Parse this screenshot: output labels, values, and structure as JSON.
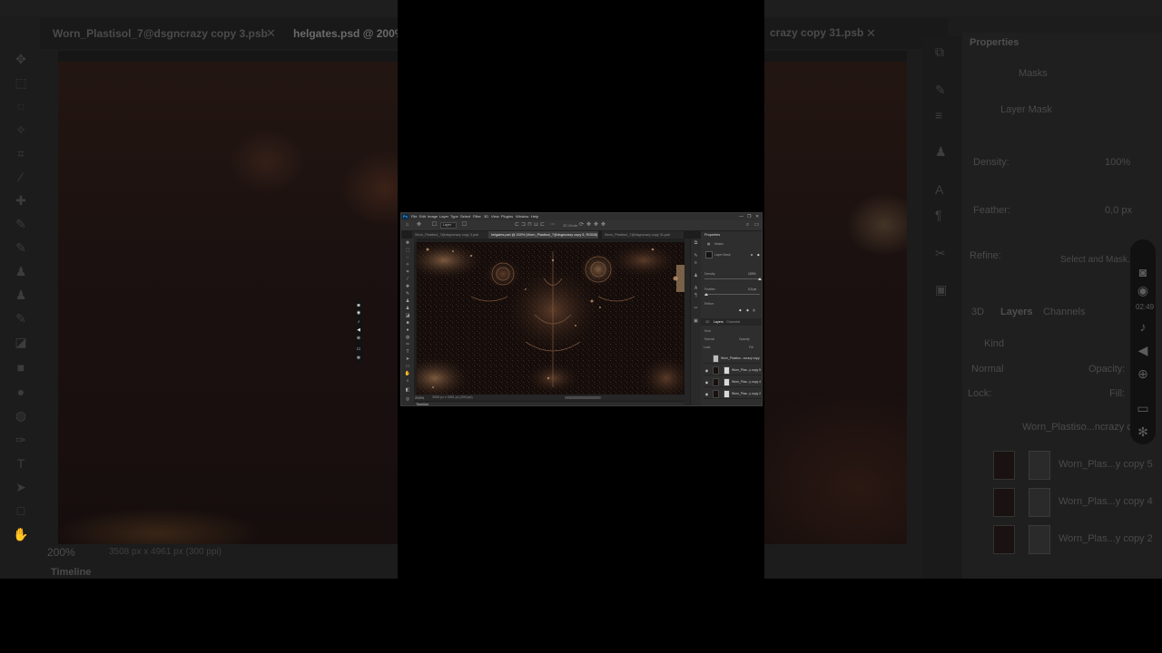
{
  "background": {
    "tabs": [
      {
        "label": "Worn_Plastisol_7@dsgncrazy copy 3.psb",
        "active": false
      },
      {
        "label": "helgates.psd @ 200%",
        "active": true
      }
    ],
    "right_tab_label": "crazy copy 31.psb",
    "status_zoom": "200%",
    "status_info": "3508 px x 4961 px (300 ppi)",
    "timeline_label": "Timeline",
    "panel": {
      "title": "Properties",
      "masks_label": "Masks",
      "layer_mask_label": "Layer Mask",
      "density_label": "Density:",
      "density_value": "100%",
      "feather_label": "Feather:",
      "feather_value": "0,0 px",
      "refine_label": "Refine:",
      "select_and_mask": "Select and Mask...",
      "tabs": [
        "3D",
        "Layers",
        "Channels"
      ],
      "kind_label": "Kind",
      "blend_mode": "Normal",
      "opacity_label": "Opacity:",
      "lock_label": "Lock:",
      "fill_label": "Fill:",
      "layers": [
        {
          "name": "Worn_Plastiso...ncrazy copy",
          "visible": false
        },
        {
          "name": "Worn_Plas...y copy 5",
          "visible": true
        },
        {
          "name": "Worn_Plas...y copy 4",
          "visible": true
        },
        {
          "name": "Worn_Plas...y copy 2",
          "visible": true
        }
      ]
    },
    "recorder_time": "02:49"
  },
  "window": {
    "menu": [
      "File",
      "Edit",
      "Image",
      "Layer",
      "Type",
      "Select",
      "Filter",
      "3D",
      "View",
      "Plugins",
      "Window",
      "Help"
    ],
    "window_controls": [
      "—",
      "❐",
      "✕"
    ],
    "options": {
      "select_value": "Layer",
      "text_3d_mode": "3D Mode:"
    },
    "tabs": [
      {
        "label": "Worn_Plastisol_7@dsgncrazy copy 3.psb",
        "active": false
      },
      {
        "label": "helgates.psd @ 200% (Worn_Plastisol_7@dsgncrazy copy 5, RGB/8)",
        "active": true
      },
      {
        "label": "Worn_Plastisol_7@dsgncrazy copy 31.psb",
        "active": false
      }
    ],
    "status": {
      "zoom": "200%",
      "info": "3508 px x 4961 px (300 ppi)"
    },
    "timeline_label": "Timeline",
    "properties": {
      "title": "Properties",
      "masks_label": "Masks",
      "layer_mask_label": "Layer Mask",
      "density_label": "Density:",
      "density_value": "100%",
      "feather_label": "Feather:",
      "feather_value": "0,0 px",
      "refine_label": "Refine:"
    },
    "layers_panel": {
      "tabs": [
        "3D",
        "Layers",
        "Channels"
      ],
      "kind_label": "Kind",
      "blend_mode": "Normal",
      "opacity_label": "Opacity:",
      "lock_label": "Lock:",
      "fill_label": "Fill:",
      "layers": [
        {
          "name": "Worn_Plastiso...ncrazy copy",
          "visible": false
        },
        {
          "name": "Worn_Plas...y copy 5",
          "visible": true
        },
        {
          "name": "Worn_Plas...y copy 4",
          "visible": true
        },
        {
          "name": "Worn_Plas...y copy 2",
          "visible": true
        }
      ]
    }
  },
  "colors": {
    "app_bg": "#262626",
    "panel_bg": "#2e2e2e",
    "accent": "#31a8ff",
    "canvas_base": "#160e0c",
    "canvas_highlight": "#a87a55"
  },
  "icons": {
    "tools": [
      "move-icon",
      "marquee-icon",
      "lasso-icon",
      "magic-wand-icon",
      "crop-icon",
      "eyedropper-icon",
      "healing-icon",
      "brush-icon",
      "stamp-icon",
      "history-brush-icon",
      "eraser-icon",
      "gradient-icon",
      "blur-icon",
      "dodge-icon",
      "pen-icon",
      "type-icon",
      "path-select-icon",
      "shape-icon",
      "hand-icon",
      "zoom-icon"
    ],
    "recorder": [
      "camera-icon",
      "record-icon",
      "mic-icon",
      "zoom-icon",
      "window-icon",
      "settings-icon"
    ]
  }
}
